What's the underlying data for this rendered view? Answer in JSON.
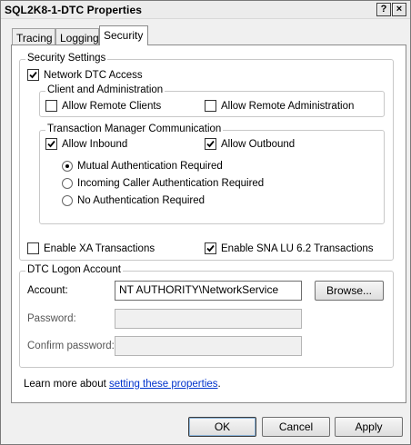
{
  "window": {
    "title": "SQL2K8-1-DTC Properties",
    "help_label": "?",
    "close_label": "×"
  },
  "tabs": [
    {
      "label": "Tracing",
      "active": false
    },
    {
      "label": "Logging",
      "active": false
    },
    {
      "label": "Security",
      "active": true
    }
  ],
  "security_settings": {
    "legend": "Security Settings",
    "network_dtc_access": {
      "label": "Network DTC Access",
      "checked": true
    },
    "client_admin": {
      "legend": "Client and Administration",
      "allow_remote_clients": {
        "label": "Allow Remote Clients",
        "checked": false
      },
      "allow_remote_admin": {
        "label": "Allow Remote Administration",
        "checked": false
      }
    },
    "tm_comm": {
      "legend": "Transaction Manager Communication",
      "allow_inbound": {
        "label": "Allow Inbound",
        "checked": true
      },
      "allow_outbound": {
        "label": "Allow Outbound",
        "checked": true
      },
      "auth_options": [
        {
          "label": "Mutual Authentication Required",
          "selected": true
        },
        {
          "label": "Incoming Caller Authentication Required",
          "selected": false
        },
        {
          "label": "No Authentication Required",
          "selected": false
        }
      ]
    },
    "enable_xa": {
      "label": "Enable XA Transactions",
      "checked": false
    },
    "enable_sna": {
      "label": "Enable SNA LU 6.2 Transactions",
      "checked": true
    }
  },
  "logon_account": {
    "legend": "DTC Logon Account",
    "account_label": "Account:",
    "account_value": "NT AUTHORITY\\NetworkService",
    "browse_label": "Browse...",
    "password_label": "Password:",
    "password_value": "",
    "confirm_label": "Confirm password:",
    "confirm_value": ""
  },
  "learn_more": {
    "prefix": "Learn more about ",
    "link_text": "setting these properties",
    "suffix": "."
  },
  "buttons": {
    "ok": "OK",
    "cancel": "Cancel",
    "apply": "Apply"
  }
}
